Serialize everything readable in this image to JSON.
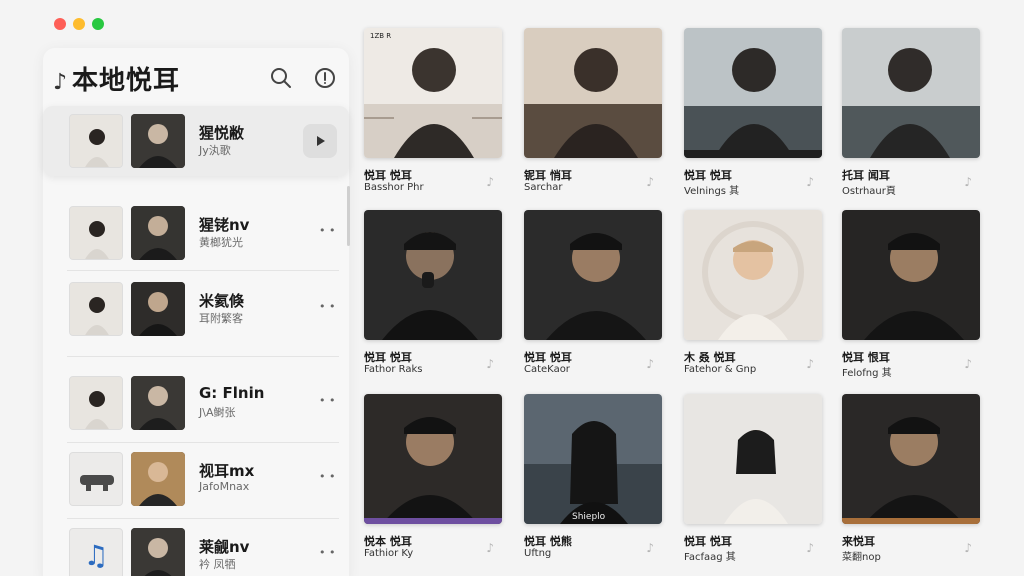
{
  "window": {
    "controls": [
      "close",
      "minimize",
      "zoom"
    ]
  },
  "sidebar": {
    "title": "本地悦耳",
    "title_icon": "music-note-icon",
    "items": [
      {
        "title": "猩悦敝",
        "subtitle": "Jy汍歌",
        "selected": true
      },
      {
        "title": "猩铑nv",
        "subtitle": "黄榔犹光"
      },
      {
        "title": "米氦倏",
        "subtitle": "耳附繁客"
      },
      {
        "title": "G: Flnin",
        "subtitle": "J\\A鲥张"
      },
      {
        "title": "视耳mx",
        "subtitle": "JafoMnax"
      },
      {
        "title": "莱觎nv",
        "subtitle": "衿 凤牺"
      }
    ],
    "row_more_glyph": "• •"
  },
  "cards": [
    {
      "title": "悦耳 悦耳",
      "subtitle": "Basshor Phr",
      "cover_label": "1ZB R"
    },
    {
      "title": "铌耳 悄耳",
      "subtitle": "Sarchar",
      "cover_label": ""
    },
    {
      "title": "悦耳 悦耳",
      "subtitle": "Velnings 其",
      "cover_label": ""
    },
    {
      "title": "托耳 闻耳",
      "subtitle": "Ostrhaur頁",
      "cover_label": ""
    },
    {
      "title": "悦耳 悦耳",
      "subtitle": "Fathor Raks",
      "cover_label": ""
    },
    {
      "title": "悦耳 悦耳",
      "subtitle": "CateKaor",
      "cover_label": ""
    },
    {
      "title": "木 叒 悦耳",
      "subtitle": "Fatehor & Gnp",
      "cover_label": ""
    },
    {
      "title": "悦耳 恨耳",
      "subtitle": "Felofng 其",
      "cover_label": ""
    },
    {
      "title": "悦本 悦耳",
      "subtitle": "Fathior Ky",
      "cover_label": ""
    },
    {
      "title": "悦耳 悦熊",
      "subtitle": "Uftng",
      "cover_label": "Shieplo"
    },
    {
      "title": "悦耳 悦耳",
      "subtitle": "Facfaag 其",
      "cover_label": ""
    },
    {
      "title": "来悦耳",
      "subtitle": "菜翻nop",
      "cover_label": ""
    }
  ],
  "card_note_glyph": "♪"
}
